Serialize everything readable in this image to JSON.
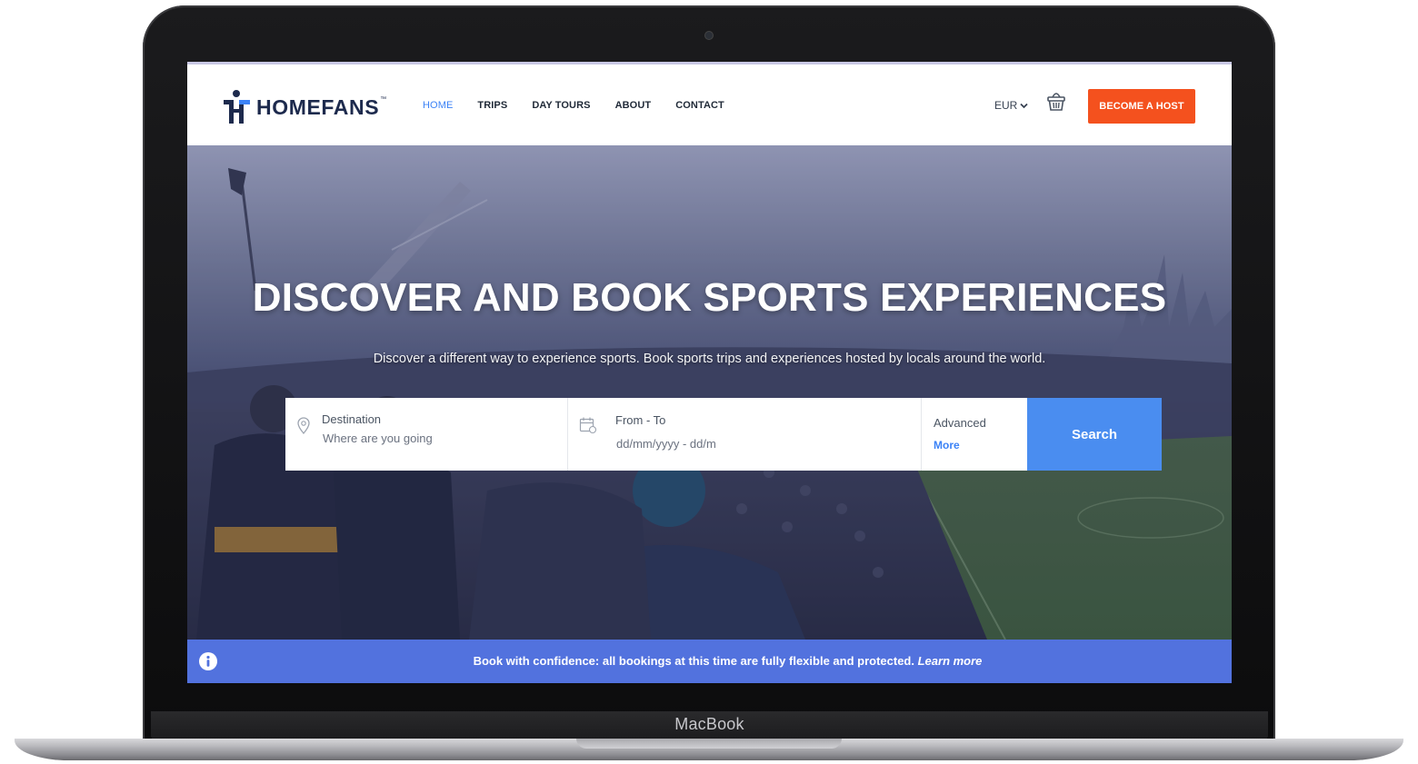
{
  "device": {
    "brand_label": "MacBook"
  },
  "header": {
    "logo_text": "HOMEFANS",
    "logo_tm": "™",
    "nav": [
      {
        "label": "HOME",
        "active": true
      },
      {
        "label": "TRIPS"
      },
      {
        "label": "DAY TOURS"
      },
      {
        "label": "ABOUT"
      },
      {
        "label": "CONTACT"
      }
    ],
    "currency": "EUR",
    "cart_icon": "basket-icon",
    "host_button": "BECOME A HOST"
  },
  "hero": {
    "title": "DISCOVER AND BOOK SPORTS EXPERIENCES",
    "subtitle": "Discover a different way to experience sports. Book sports trips and experiences hosted by locals around the world."
  },
  "search": {
    "destination_label": "Destination",
    "destination_placeholder": "Where are you going",
    "dates_label": "From - To",
    "dates_placeholder": "dd/mm/yyyy - dd/m",
    "advanced_label": "Advanced",
    "more_link": "More",
    "search_button": "Search"
  },
  "banner": {
    "text": "Book with confidence: all bookings at this time are fully flexible and protected.",
    "link": "Learn more",
    "icon": "info-icon"
  },
  "colors": {
    "accent_blue": "#3b82f6",
    "cta_orange": "#f4511e",
    "banner_blue": "#5272de",
    "search_button": "#4a8df0",
    "navy": "#1d2a4d"
  }
}
